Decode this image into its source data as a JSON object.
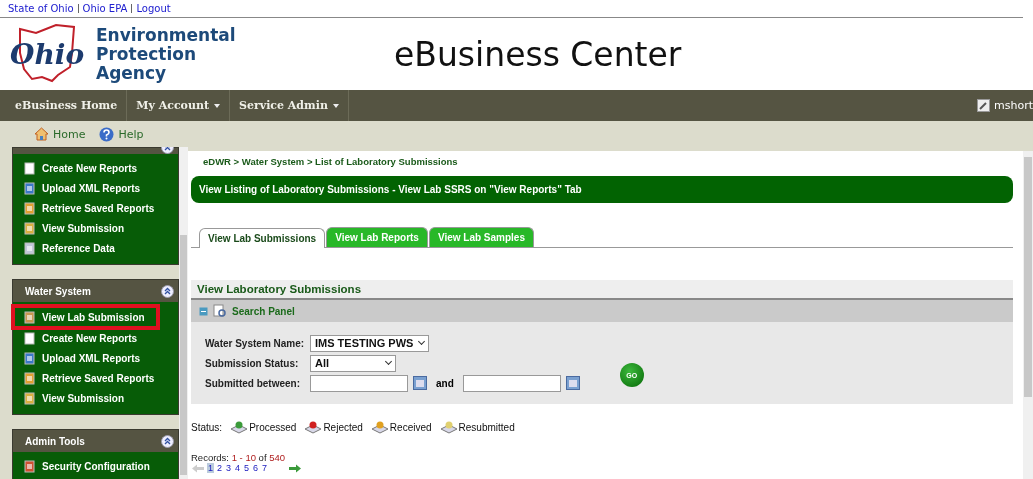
{
  "top_links": [
    "State of Ohio",
    "Ohio EPA",
    "Logout"
  ],
  "logo": {
    "script": "Ohio",
    "agency": [
      "Environmental",
      "Protection",
      "Agency"
    ]
  },
  "title": "eBusiness Center",
  "nav": {
    "items": [
      {
        "label": "eBusiness Home",
        "dropdown": false
      },
      {
        "label": "My Account",
        "dropdown": true
      },
      {
        "label": "Service Admin",
        "dropdown": true
      }
    ],
    "user": "mshort"
  },
  "toolbar": [
    {
      "label": "Home",
      "kind": "home"
    },
    {
      "label": "Help",
      "kind": "help"
    }
  ],
  "sidebar": {
    "sections": [
      {
        "items": [
          {
            "label": "Create New Reports",
            "kind": "page",
            "highlighted": false
          },
          {
            "label": "Upload XML Reports",
            "kind": "upload",
            "highlighted": false
          },
          {
            "label": "Retrieve Saved Reports",
            "kind": "edit",
            "highlighted": false
          },
          {
            "label": "View Submission",
            "kind": "lock",
            "highlighted": false
          },
          {
            "label": "Reference Data",
            "kind": "search",
            "highlighted": false
          }
        ]
      },
      {
        "title": "Water System",
        "items": [
          {
            "label": "View Lab Submission",
            "kind": "lab",
            "highlighted": true
          },
          {
            "label": "Create New Reports",
            "kind": "page",
            "highlighted": false
          },
          {
            "label": "Upload XML Reports",
            "kind": "upload",
            "highlighted": false
          },
          {
            "label": "Retrieve Saved Reports",
            "kind": "edit",
            "highlighted": false
          },
          {
            "label": "View Submission",
            "kind": "lock",
            "highlighted": false
          }
        ]
      },
      {
        "title": "Admin Tools",
        "items": [
          {
            "label": "Security Configuration",
            "kind": "users",
            "highlighted": false
          }
        ]
      }
    ]
  },
  "breadcrumb": "eDWR > Water System > List of Laboratory Submissions",
  "banner": "View Listing of Laboratory Submissions - View Lab SSRS on \"View Reports\" Tab",
  "tabs": [
    {
      "label": "View Lab Submissions",
      "selected": true
    },
    {
      "label": "View Lab Reports",
      "selected": false
    },
    {
      "label": "View Lab Samples",
      "selected": false
    }
  ],
  "panel": {
    "title": "View Laboratory Submissions",
    "search_panel": {
      "title": "Search Panel",
      "expanded": true,
      "fields": [
        {
          "label": "Water System Name:",
          "kind": "select",
          "value": "IMS TESTING PWS"
        },
        {
          "label": "Submission Status:",
          "kind": "select",
          "value": "All"
        },
        {
          "label": "Submitted between:",
          "kind": "daterange",
          "joiner": "and"
        }
      ],
      "button": "GO"
    }
  },
  "status_legend": {
    "label": "Status:",
    "items": [
      {
        "label": "Processed",
        "kind": "processed"
      },
      {
        "label": "Rejected",
        "kind": "rejected"
      },
      {
        "label": "Received",
        "kind": "received"
      },
      {
        "label": "Resubmitted",
        "kind": "resubmitted"
      }
    ]
  },
  "records": {
    "label": "Records:",
    "range": "1 - 10",
    "of": "of",
    "total": "540"
  },
  "pages": [
    {
      "label": "1",
      "selected": true
    },
    {
      "label": "2",
      "selected": false
    },
    {
      "label": "3",
      "selected": false
    },
    {
      "label": "4",
      "selected": false
    },
    {
      "label": "5",
      "selected": false
    },
    {
      "label": "6",
      "selected": false
    },
    {
      "label": "7",
      "selected": false
    }
  ]
}
